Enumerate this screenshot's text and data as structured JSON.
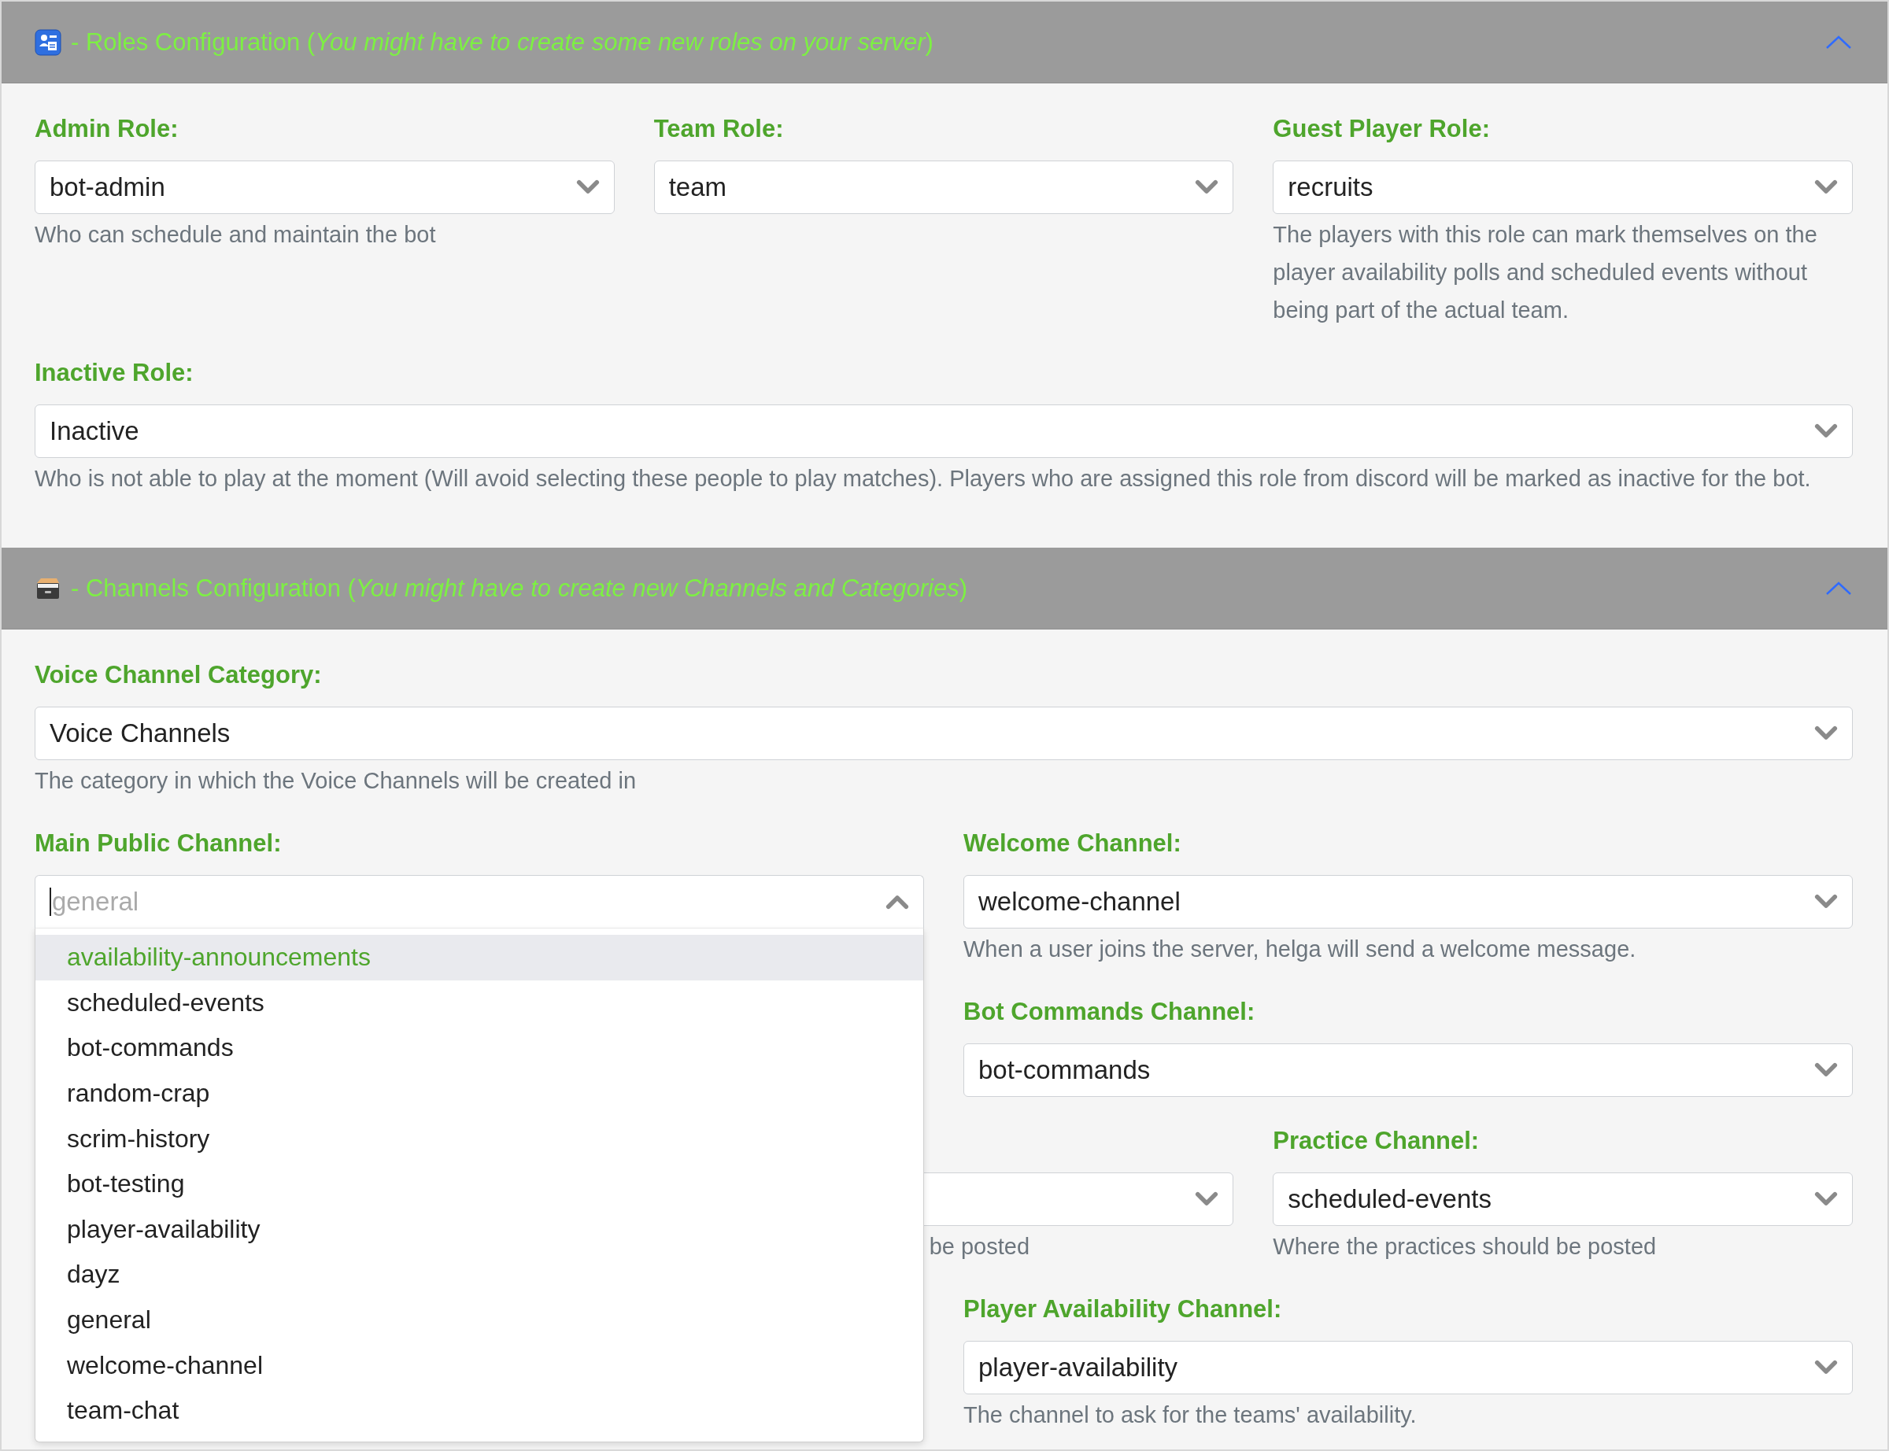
{
  "sections": [
    {
      "kind": "roles",
      "title": "- Roles Configuration (*You might have to create some new roles on your server*)",
      "expanded": true,
      "rows": [
        {
          "fields": [
            {
              "kind": "select",
              "label": "Admin Role:",
              "value": "bot-admin",
              "help": "Who can schedule and maintain the bot"
            },
            {
              "kind": "select",
              "label": "Team Role:",
              "value": "team"
            },
            {
              "kind": "select",
              "label": "Guest Player Role:",
              "value": "recruits",
              "help": "The players with this role can mark themselves on the player availability polls and scheduled events without being part of the actual team."
            }
          ]
        },
        {
          "fields": [
            {
              "kind": "select",
              "label": "Inactive Role:",
              "value": "Inactive",
              "help": "Who is not able to play at the moment (Will avoid selecting these people to play matches). Players who are assigned this role from discord will be marked as inactive for the bot."
            }
          ]
        }
      ]
    },
    {
      "kind": "channels",
      "title": "- Channels Configuration (*You might have to create new Channels and Categories*)",
      "expanded": true,
      "rows": [
        {
          "fields": [
            {
              "kind": "select",
              "label": "Voice Channel Category:",
              "value": "Voice Channels",
              "help": "The category in which the Voice Channels will be created in"
            }
          ]
        },
        {
          "fields": [
            {
              "kind": "dropdown",
              "label": "Main Public Channel:",
              "placeholder": "general",
              "open": true,
              "options": [
                {
                  "label": "availability-announcements",
                  "highlighted": true
                },
                {
                  "label": "scheduled-events",
                  "highlighted": false
                },
                {
                  "label": "bot-commands",
                  "highlighted": false
                },
                {
                  "label": "random-crap",
                  "highlighted": false
                },
                {
                  "label": "scrim-history",
                  "highlighted": false
                },
                {
                  "label": "bot-testing",
                  "highlighted": false
                },
                {
                  "label": "player-availability",
                  "highlighted": false
                },
                {
                  "label": "dayz",
                  "highlighted": false
                },
                {
                  "label": "general",
                  "highlighted": false
                },
                {
                  "label": "welcome-channel",
                  "highlighted": false
                },
                {
                  "label": "team-chat",
                  "highlighted": false
                }
              ]
            },
            {
              "kind": "stack",
              "fields": [
                {
                  "kind": "select",
                  "label": "Welcome Channel:",
                  "value": "welcome-channel",
                  "help": "When a user joins the server, helga will send a welcome message."
                },
                {
                  "kind": "select",
                  "label": "Bot Commands Channel:",
                  "value": "bot-commands"
                }
              ]
            }
          ]
        },
        {
          "fields": [
            {
              "kind": "covered"
            },
            {
              "kind": "partial",
              "help": "be posted"
            },
            {
              "kind": "select",
              "label": "Practice Channel:",
              "value": "scheduled-events",
              "help": "Where the practices should be posted"
            }
          ]
        },
        {
          "fields": [
            {
              "kind": "covered"
            },
            {
              "kind": "select",
              "label": "Player Availability Channel:",
              "value": "player-availability",
              "help": "The channel to ask for the teams' availability."
            }
          ]
        }
      ]
    }
  ]
}
